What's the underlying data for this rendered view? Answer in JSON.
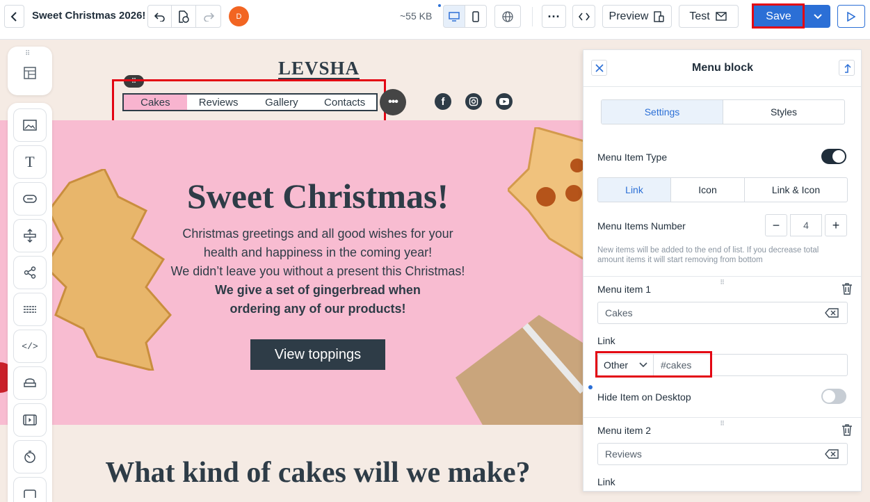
{
  "topbar": {
    "title": "Sweet Christmas 2026!",
    "size": "~55 KB",
    "preview_label": "Preview",
    "test_label": "Test",
    "save_label": "Save",
    "avatar_initial": "D",
    "accent_color": "#2b6fd6"
  },
  "canvas": {
    "logo": "LEVSHA",
    "menu_items": [
      "Cakes",
      "Reviews",
      "Gallery",
      "Contacts"
    ],
    "hero_title": "Sweet Christmas!",
    "hero_lines": [
      "Christmas greetings and all good wishes for your",
      "health and happiness in the coming year!",
      "We didn’t leave you without a present this Christmas!"
    ],
    "hero_bold_lines": [
      "We give a set of gingerbread when",
      "ordering any of our products!"
    ],
    "cta_label": "View toppings",
    "section2_title": "What kind of cakes will we make?",
    "hero_bg": "#f8bcd1"
  },
  "panel": {
    "title": "Menu block",
    "tabs": [
      "Settings",
      "Styles"
    ],
    "menu_item_type_label": "Menu Item Type",
    "type_options": [
      "Link",
      "Icon",
      "Link & Icon"
    ],
    "items_number_label": "Menu Items Number",
    "items_number": "4",
    "hint": "New items will be added to the end of list. If you decrease total amount items it will start removing from bottom",
    "item1": {
      "label": "Menu item 1",
      "value": "Cakes",
      "link_label": "Link",
      "link_type": "Other",
      "link_value": "#cakes",
      "hide_label": "Hide Item on Desktop"
    },
    "item2": {
      "label": "Menu item 2",
      "value": "Reviews",
      "link_label": "Link"
    }
  }
}
